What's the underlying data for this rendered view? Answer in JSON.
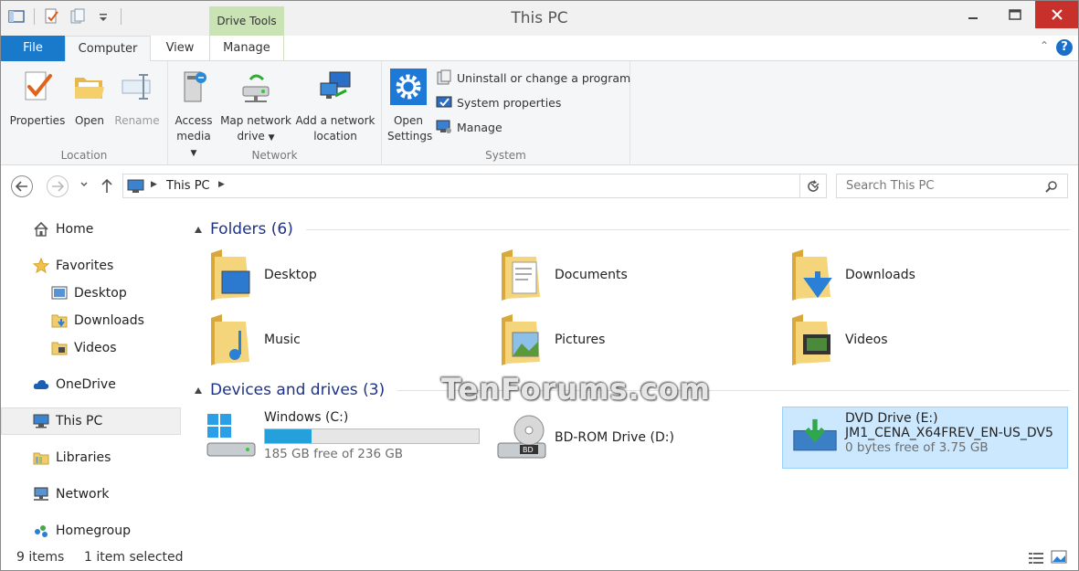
{
  "window": {
    "title": "This PC"
  },
  "contextual_tab": {
    "group_label": "Drive Tools"
  },
  "tabs": [
    {
      "label": "File"
    },
    {
      "label": "Computer"
    },
    {
      "label": "View"
    },
    {
      "label": "Manage"
    }
  ],
  "ribbon": {
    "location": {
      "label": "Location",
      "properties": "Properties",
      "open": "Open",
      "rename": "Rename"
    },
    "network": {
      "label": "Network",
      "access_media_1": "Access",
      "access_media_2": "media",
      "map_drive_1": "Map network",
      "map_drive_2": "drive",
      "add_location_1": "Add a network",
      "add_location_2": "location"
    },
    "system": {
      "label": "System",
      "open_settings_1": "Open",
      "open_settings_2": "Settings",
      "uninstall": "Uninstall or change a program",
      "system_properties": "System properties",
      "manage": "Manage"
    }
  },
  "address": {
    "path": "This PC"
  },
  "search": {
    "placeholder": "Search This PC"
  },
  "nav_pane": {
    "home": "Home",
    "favorites": "Favorites",
    "fav_desktop": "Desktop",
    "fav_downloads": "Downloads",
    "fav_videos": "Videos",
    "onedrive": "OneDrive",
    "this_pc": "This PC",
    "libraries": "Libraries",
    "network": "Network",
    "homegroup": "Homegroup"
  },
  "folders_section": {
    "title": "Folders (6)",
    "items": [
      {
        "name": "Desktop"
      },
      {
        "name": "Documents"
      },
      {
        "name": "Downloads"
      },
      {
        "name": "Music"
      },
      {
        "name": "Pictures"
      },
      {
        "name": "Videos"
      }
    ]
  },
  "drives_section": {
    "title": "Devices and drives (3)",
    "windows": {
      "name": "Windows (C:)",
      "free": "185 GB free of 236 GB",
      "used_fraction": 0.22
    },
    "bdrom": {
      "name": "BD-ROM Drive (D:)"
    },
    "dvd": {
      "name": "DVD Drive (E:)",
      "label": "JM1_CENA_X64FREV_EN-US_DV5",
      "free": "0 bytes free of 3.75 GB"
    }
  },
  "status": {
    "items": "9 items",
    "selected": "1 item selected"
  },
  "watermark": "TenForums.com",
  "colors": {
    "accent": "#1979ca",
    "selection": "#cce8ff",
    "section_heading": "#1e3287",
    "drive_bar": "#26a0da"
  }
}
